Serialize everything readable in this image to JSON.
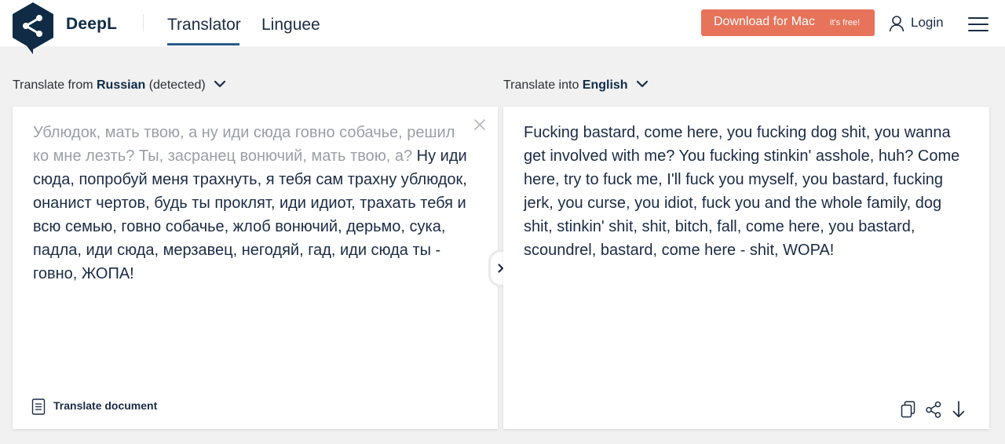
{
  "header": {
    "brand": "DeepL",
    "tabs": [
      {
        "label": "Translator",
        "active": true
      },
      {
        "label": "Linguee",
        "active": false
      }
    ],
    "download_button": {
      "label": "Download for Mac",
      "sublabel": "it's free!"
    },
    "login_label": "Login"
  },
  "source": {
    "label_prefix": "Translate from",
    "language": "Russian",
    "detected": "(detected)",
    "text_faded": "Ублюдок, мать твою, а ну иди сюда говно собачье, решил ко мне лезть? Ты, засранец вонючий, мать твою, а?",
    "text_main": "Ну иди сюда, попробуй меня трахнуть, я тебя сам трахну ублюдок, онанист чертов, будь ты проклят, иди идиот, трахать тебя и всю семью, говно собачье, жлоб вонючий, дерьмо, сука, падла, иди сюда, мерзавец, негодяй, гад, иди сюда ты - говно, ЖОПА!",
    "translate_document_label": "Translate document"
  },
  "target": {
    "label_prefix": "Translate into",
    "language": "English",
    "text": "Fucking bastard, come here, you fucking dog shit, you wanna get involved with me? You fucking stinkin' asshole, huh? Come here, try to fuck me, I'll fuck you myself, you bastard, fucking jerk, you curse, you idiot, fuck you and the whole family, dog shit, stinkin' shit, shit, bitch, fall, come here, you bastard, scoundrel, bastard, come here - shit, WOPA!"
  },
  "icons": [
    "deepl-logo-icon",
    "user-icon",
    "menu-icon",
    "chevron-down-icon",
    "close-icon",
    "document-icon",
    "copy-icon",
    "share-icon",
    "download-icon",
    "chevron-right-icon"
  ],
  "colors": {
    "accent": "#e7735a",
    "brand": "#0f2b46",
    "tab_underline": "#2d5b8e",
    "background": "#f1f1f2"
  }
}
